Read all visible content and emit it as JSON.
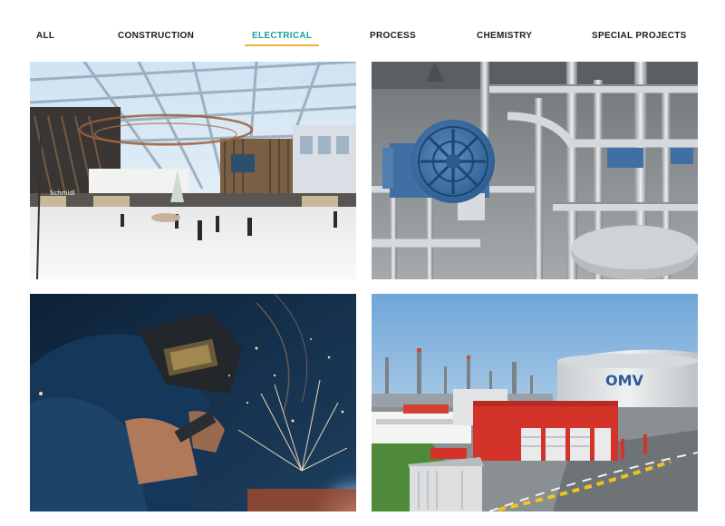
{
  "filters": {
    "active": "electrical",
    "items": [
      {
        "id": "all",
        "label": "ALL"
      },
      {
        "id": "construction",
        "label": "CONSTRUCTION"
      },
      {
        "id": "electrical",
        "label": "ELECTRICAL"
      },
      {
        "id": "process",
        "label": "PROCESS"
      },
      {
        "id": "chemistry",
        "label": "CHEMISTRY"
      },
      {
        "id": "special",
        "label": "SPECIAL PROJECTS"
      }
    ]
  },
  "colors": {
    "active_tab": "#1aa39e",
    "active_underline": "#f0b429",
    "tab_text": "#1c1c1c"
  },
  "gallery": {
    "tiles": [
      {
        "subject": "shopping-mall-atrium-photo",
        "sign_text": "Schmidl"
      },
      {
        "subject": "industrial-motor-pipework-photo"
      },
      {
        "subject": "welder-sparks-photo"
      },
      {
        "subject": "refinery-station-building-photo",
        "tank_logo": "OMV"
      }
    ]
  }
}
